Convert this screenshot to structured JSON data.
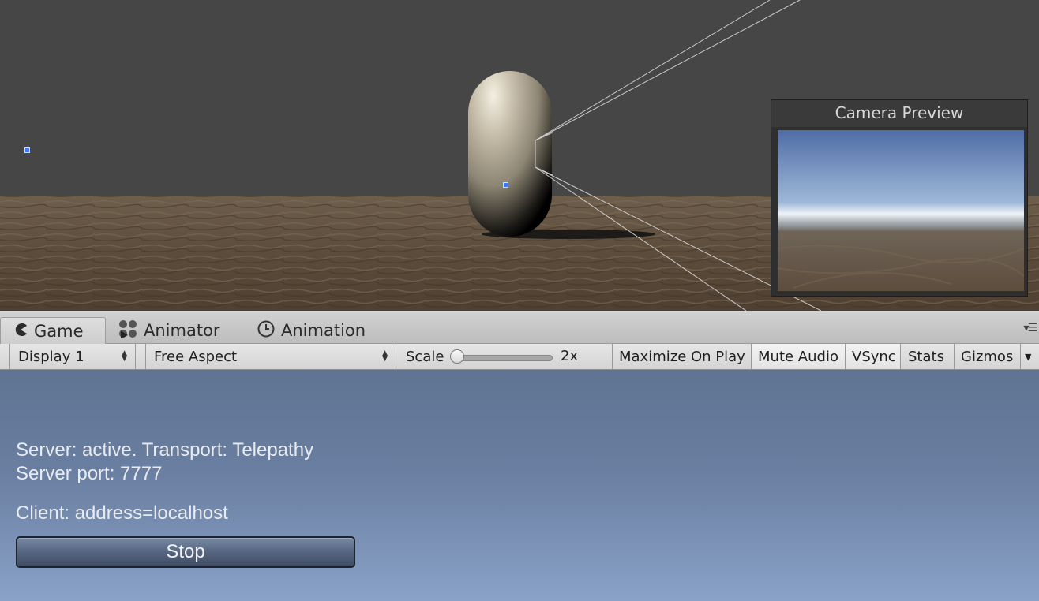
{
  "scene": {
    "camera_preview_title": "Camera Preview"
  },
  "tabs": [
    {
      "label": "Game",
      "icon": "pacman-icon",
      "active": true
    },
    {
      "label": "Animator",
      "icon": "animator-icon",
      "active": false
    },
    {
      "label": "Animation",
      "icon": "clock-icon",
      "active": false
    }
  ],
  "toolbar": {
    "display": "Display 1",
    "aspect": "Free Aspect",
    "scale_label": "Scale",
    "scale_value": "2x",
    "maximize_on_play": "Maximize On Play",
    "mute_audio": "Mute Audio",
    "vsync": "VSync",
    "stats": "Stats",
    "gizmos": "Gizmos"
  },
  "game": {
    "server_status": "Server: active. Transport: Telepathy",
    "server_port": "Server port: 7777",
    "client_address": "Client: address=localhost",
    "stop_label": "Stop"
  },
  "colors": {
    "scene_bg": "#464646",
    "game_sky_top": "#5f7493",
    "game_sky_bottom": "#8aa2c8",
    "selection_handle": "#3b7bff"
  }
}
